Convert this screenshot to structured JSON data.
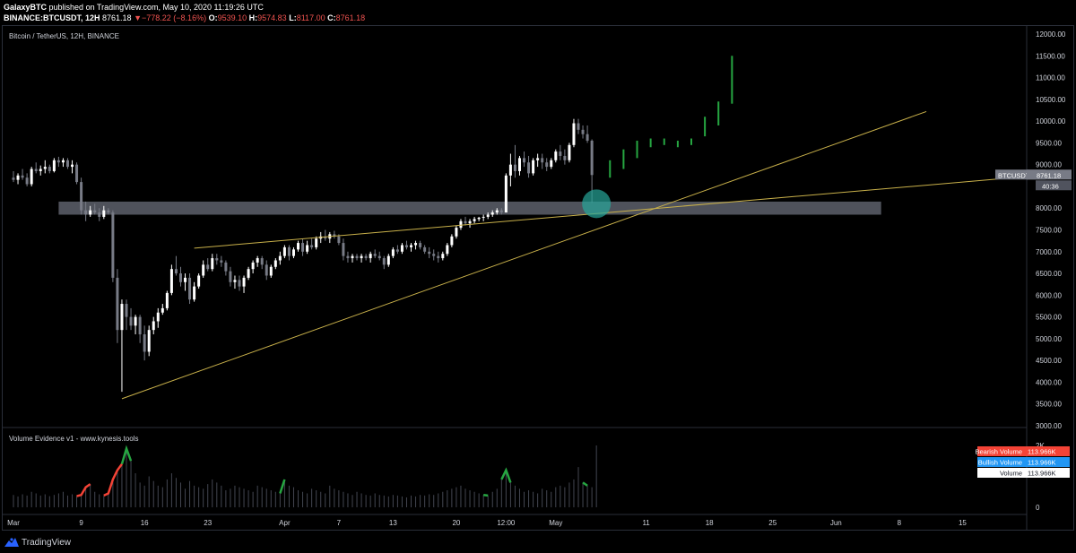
{
  "header": {
    "line1": {
      "author": "GalaxyBTC",
      "rest": " published on TradingView.com, May 10, 2020 11:19:26 UTC"
    },
    "line2": {
      "symbol": "BINANCE:BTCUSDT, 12H",
      "last": "8761.18",
      "change": "−778.22 (−8.16%)",
      "o_label": "O:",
      "o_val": "9539.10",
      "h_label": "H:",
      "h_val": "9574.83",
      "l_label": "L:",
      "l_val": "8117.00",
      "c_label": "C:",
      "c_val": "8761.18"
    }
  },
  "colors": {
    "background": "#000000",
    "bull_candle": "#ffffff",
    "bear_candle": "#787b86",
    "projection": "#26a641",
    "trendline": "#c8b04a",
    "zone": "#5d606b",
    "circle": "#26a69a",
    "bearish_volume": "#f44336",
    "bullish_volume": "#2196f3",
    "volume_tag": "#ffffff"
  },
  "footer": {
    "brand": "TradingView",
    "logo_icon": "tradingview-logo-icon"
  },
  "chart_data": {
    "type": "candlestick",
    "title": "Bitcoin / TetherUS, 12H, BINANCE",
    "timeframe": "12H",
    "ylim": [
      3000,
      12000
    ],
    "y_ticks": [
      "3000.00",
      "3500.00",
      "4000.00",
      "4500.00",
      "5000.00",
      "5500.00",
      "6000.00",
      "6500.00",
      "7000.00",
      "7500.00",
      "8000.00",
      "8500.00",
      "9000.00",
      "9500.00",
      "10000.00",
      "10500.00",
      "11000.00",
      "11500.00",
      "12000.00"
    ],
    "x_ticks": [
      {
        "label": "Mar",
        "bar": 0
      },
      {
        "label": "9",
        "bar": 15
      },
      {
        "label": "16",
        "bar": 29
      },
      {
        "label": "23",
        "bar": 43
      },
      {
        "label": "Apr",
        "bar": 60
      },
      {
        "label": "7",
        "bar": 72
      },
      {
        "label": "13",
        "bar": 84
      },
      {
        "label": "20",
        "bar": 98
      },
      {
        "label": "12:00",
        "bar": 109
      },
      {
        "label": "May",
        "bar": 120
      },
      {
        "label": "11",
        "bar": 140
      },
      {
        "label": "18",
        "bar": 154
      },
      {
        "label": "25",
        "bar": 168
      },
      {
        "label": "Jun",
        "bar": 182
      },
      {
        "label": "8",
        "bar": 196
      },
      {
        "label": "15",
        "bar": 210
      }
    ],
    "price_label": {
      "symbol": "BTCUSDT",
      "value": "8761.18",
      "countdown": "40:36"
    },
    "candles": [
      [
        8700,
        8850,
        8600,
        8650
      ],
      [
        8650,
        8800,
        8550,
        8750
      ],
      [
        8750,
        8900,
        8650,
        8700
      ],
      [
        8700,
        8800,
        8500,
        8550
      ],
      [
        8550,
        8950,
        8500,
        8900
      ],
      [
        8900,
        9050,
        8800,
        8850
      ],
      [
        8850,
        8980,
        8750,
        8900
      ],
      [
        8900,
        9100,
        8800,
        8950
      ],
      [
        8950,
        9000,
        8800,
        8850
      ],
      [
        8850,
        9150,
        8820,
        9100
      ],
      [
        9100,
        9180,
        8950,
        9050
      ],
      [
        9050,
        9150,
        8950,
        9100
      ],
      [
        9100,
        9150,
        8900,
        8950
      ],
      [
        8950,
        9100,
        8800,
        9000
      ],
      [
        9000,
        9050,
        8550,
        8600
      ],
      [
        8600,
        8700,
        7850,
        7950
      ],
      [
        7950,
        8150,
        7700,
        7850
      ],
      [
        7850,
        8050,
        7800,
        7950
      ],
      [
        7950,
        8100,
        7850,
        7900
      ],
      [
        7900,
        8000,
        7700,
        7800
      ],
      [
        7800,
        8050,
        7750,
        7950
      ],
      [
        7950,
        8000,
        7850,
        7900
      ],
      [
        7900,
        7950,
        6300,
        6400
      ],
      [
        6400,
        6600,
        4900,
        5200
      ],
      [
        5200,
        5900,
        3780,
        5800
      ],
      [
        5800,
        5900,
        5200,
        5500
      ],
      [
        5500,
        5700,
        5200,
        5300
      ],
      [
        5300,
        5550,
        5100,
        5500
      ],
      [
        5500,
        5550,
        4900,
        5100
      ],
      [
        5100,
        5300,
        4500,
        4700
      ],
      [
        4700,
        5300,
        4600,
        5200
      ],
      [
        5200,
        5500,
        5100,
        5400
      ],
      [
        5400,
        5700,
        5250,
        5600
      ],
      [
        5600,
        5800,
        5550,
        5700
      ],
      [
        5700,
        6100,
        5650,
        6050
      ],
      [
        6050,
        6700,
        6000,
        6600
      ],
      [
        6600,
        6900,
        6450,
        6500
      ],
      [
        6500,
        6650,
        6200,
        6300
      ],
      [
        6300,
        6500,
        6100,
        6400
      ],
      [
        6400,
        6500,
        5800,
        5900
      ],
      [
        5900,
        6300,
        5850,
        6200
      ],
      [
        6200,
        6500,
        6150,
        6450
      ],
      [
        6450,
        6800,
        6400,
        6700
      ],
      [
        6700,
        6850,
        6550,
        6600
      ],
      [
        6600,
        6950,
        6550,
        6850
      ],
      [
        6850,
        6950,
        6700,
        6800
      ],
      [
        6800,
        6900,
        6650,
        6750
      ],
      [
        6750,
        6800,
        6450,
        6550
      ],
      [
        6550,
        6650,
        6200,
        6300
      ],
      [
        6300,
        6450,
        6150,
        6350
      ],
      [
        6350,
        6450,
        6100,
        6200
      ],
      [
        6200,
        6450,
        6050,
        6400
      ],
      [
        6400,
        6650,
        6350,
        6600
      ],
      [
        6600,
        6800,
        6500,
        6750
      ],
      [
        6750,
        6900,
        6650,
        6850
      ],
      [
        6850,
        6900,
        6600,
        6700
      ],
      [
        6700,
        6800,
        6350,
        6450
      ],
      [
        6450,
        6700,
        6400,
        6650
      ],
      [
        6650,
        6850,
        6600,
        6800
      ],
      [
        6800,
        7000,
        6700,
        6900
      ],
      [
        6900,
        7150,
        6850,
        7100
      ],
      [
        7100,
        7150,
        6800,
        6900
      ],
      [
        6900,
        7100,
        6850,
        7050
      ],
      [
        7050,
        7250,
        7000,
        7200
      ],
      [
        7200,
        7300,
        6900,
        7000
      ],
      [
        7000,
        7250,
        6950,
        7150
      ],
      [
        7150,
        7300,
        7050,
        7100
      ],
      [
        7100,
        7350,
        7050,
        7300
      ],
      [
        7300,
        7450,
        7200,
        7350
      ],
      [
        7350,
        7500,
        7250,
        7300
      ],
      [
        7300,
        7450,
        7200,
        7400
      ],
      [
        7400,
        7480,
        7300,
        7350
      ],
      [
        7350,
        7400,
        7150,
        7200
      ],
      [
        7200,
        7300,
        6800,
        6900
      ],
      [
        6900,
        7000,
        6750,
        6850
      ],
      [
        6850,
        6950,
        6750,
        6900
      ],
      [
        6900,
        6950,
        6800,
        6850
      ],
      [
        6850,
        6950,
        6750,
        6900
      ],
      [
        6900,
        6950,
        6800,
        6850
      ],
      [
        6850,
        7000,
        6750,
        6950
      ],
      [
        6950,
        7050,
        6850,
        6900
      ],
      [
        6900,
        7000,
        6800,
        6850
      ],
      [
        6850,
        6900,
        6600,
        6700
      ],
      [
        6700,
        6950,
        6650,
        6900
      ],
      [
        6900,
        7100,
        6850,
        7050
      ],
      [
        7050,
        7150,
        6950,
        7000
      ],
      [
        7000,
        7200,
        6950,
        7150
      ],
      [
        7150,
        7250,
        7050,
        7100
      ],
      [
        7100,
        7200,
        7000,
        7150
      ],
      [
        7150,
        7250,
        7050,
        7200
      ],
      [
        7200,
        7250,
        7050,
        7100
      ],
      [
        7100,
        7150,
        6950,
        7000
      ],
      [
        7000,
        7100,
        6850,
        6950
      ],
      [
        6950,
        7050,
        6800,
        6900
      ],
      [
        6900,
        7000,
        6750,
        6850
      ],
      [
        6850,
        7000,
        6800,
        6950
      ],
      [
        6950,
        7200,
        6900,
        7150
      ],
      [
        7150,
        7400,
        7100,
        7350
      ],
      [
        7350,
        7600,
        7300,
        7550
      ],
      [
        7550,
        7750,
        7500,
        7700
      ],
      [
        7700,
        7800,
        7600,
        7650
      ],
      [
        7650,
        7750,
        7550,
        7700
      ],
      [
        7700,
        7800,
        7650,
        7750
      ],
      [
        7750,
        7800,
        7700,
        7780
      ],
      [
        7780,
        7850,
        7700,
        7800
      ],
      [
        7800,
        7900,
        7750,
        7850
      ],
      [
        7850,
        7950,
        7800,
        7900
      ],
      [
        7900,
        8000,
        7850,
        7950
      ],
      [
        7950,
        8000,
        7850,
        7900
      ],
      [
        7900,
        8800,
        7900,
        8750
      ],
      [
        8750,
        9250,
        8500,
        9000
      ],
      [
        9000,
        9450,
        8700,
        8850
      ],
      [
        8850,
        9200,
        8750,
        9150
      ],
      [
        9150,
        9300,
        8950,
        9050
      ],
      [
        9050,
        9200,
        8700,
        8800
      ],
      [
        8800,
        9150,
        8750,
        9100
      ],
      [
        9100,
        9250,
        8950,
        9150
      ],
      [
        9150,
        9250,
        8900,
        9050
      ],
      [
        9050,
        9150,
        8850,
        8950
      ],
      [
        8950,
        9150,
        8900,
        9100
      ],
      [
        9100,
        9350,
        9050,
        9300
      ],
      [
        9300,
        9450,
        9100,
        9200
      ],
      [
        9200,
        9350,
        9000,
        9100
      ],
      [
        9100,
        9500,
        9050,
        9450
      ],
      [
        9450,
        10050,
        9400,
        9950
      ],
      [
        9950,
        10050,
        9700,
        9800
      ],
      [
        9800,
        9900,
        9600,
        9700
      ],
      [
        9700,
        9900,
        9500,
        9550
      ],
      [
        9550,
        9580,
        8117,
        8761
      ]
    ],
    "projection": [
      {
        "bar": 132,
        "low": 8700,
        "high": 9100
      },
      {
        "bar": 135,
        "low": 8900,
        "high": 9350
      },
      {
        "bar": 138,
        "low": 9150,
        "high": 9550
      },
      {
        "bar": 141,
        "low": 9400,
        "high": 9600
      },
      {
        "bar": 144,
        "low": 9450,
        "high": 9600
      },
      {
        "bar": 147,
        "low": 9400,
        "high": 9550
      },
      {
        "bar": 150,
        "low": 9450,
        "high": 9600
      },
      {
        "bar": 153,
        "low": 9650,
        "high": 10100
      },
      {
        "bar": 156,
        "low": 9900,
        "high": 10450
      },
      {
        "bar": 159,
        "low": 10400,
        "high": 11500
      }
    ],
    "trendlines": [
      {
        "from": {
          "bar": 24,
          "price": 3620
        },
        "to": {
          "bar": 202,
          "price": 10220
        }
      },
      {
        "from": {
          "bar": 40,
          "price": 7080
        },
        "to": {
          "bar": 228,
          "price": 8760
        }
      }
    ],
    "zone": {
      "from_bar": 10,
      "to_bar": 192,
      "low": 7850,
      "high": 8150
    },
    "circle": {
      "bar": 129,
      "price": 8100
    },
    "volume_indicator": {
      "title": "Volume Evidence v1 - www.kynesis.tools",
      "ylim": [
        0,
        2000
      ],
      "y_ticks": [
        "0",
        "2K"
      ],
      "values": [
        400,
        350,
        420,
        380,
        500,
        450,
        380,
        420,
        360,
        400,
        450,
        500,
        380,
        420,
        360,
        400,
        650,
        750,
        500,
        420,
        380,
        450,
        900,
        1200,
        1400,
        1900,
        1500,
        1100,
        800,
        700,
        1000,
        850,
        700,
        650,
        900,
        1100,
        950,
        800,
        600,
        850,
        700,
        650,
        600,
        750,
        900,
        800,
        700,
        550,
        600,
        700,
        650,
        600,
        550,
        500,
        700,
        650,
        600,
        550,
        500,
        450,
        900,
        700,
        650,
        550,
        500,
        450,
        600,
        550,
        500,
        450,
        700,
        600,
        550,
        500,
        450,
        400,
        500,
        450,
        400,
        380,
        450,
        400,
        380,
        350,
        400,
        380,
        350,
        320,
        380,
        350,
        400,
        380,
        420,
        400,
        450,
        500,
        550,
        600,
        650,
        700,
        600,
        550,
        500,
        450,
        400,
        380,
        500,
        600,
        900,
        1200,
        800,
        700,
        600,
        500,
        550,
        500,
        450,
        600,
        550,
        500,
        650,
        700,
        650,
        800,
        900,
        1300,
        800,
        700,
        650,
        2000
      ],
      "highlights": [
        {
          "color": "bearish",
          "bars": [
            14,
            15,
            16,
            17
          ]
        },
        {
          "color": "bearish",
          "bars": [
            20,
            21,
            22,
            23,
            24
          ]
        },
        {
          "color": "bullish",
          "bars": [
            24,
            25,
            26
          ]
        },
        {
          "color": "bullish",
          "bars": [
            59,
            60
          ]
        },
        {
          "color": "bullish",
          "bars": [
            104,
            105
          ]
        },
        {
          "color": "bullish",
          "bars": [
            108,
            109,
            110
          ]
        },
        {
          "color": "bullish",
          "bars": [
            126,
            127
          ]
        },
        {
          "color": "bearish",
          "bars": [
            131,
            132
          ]
        }
      ],
      "tags": [
        {
          "label": "Bearish Volume",
          "value": "113.966K"
        },
        {
          "label": "Bullish Volume",
          "value": "113.966K"
        },
        {
          "label": "Volume",
          "value": "113.966K"
        }
      ]
    }
  }
}
